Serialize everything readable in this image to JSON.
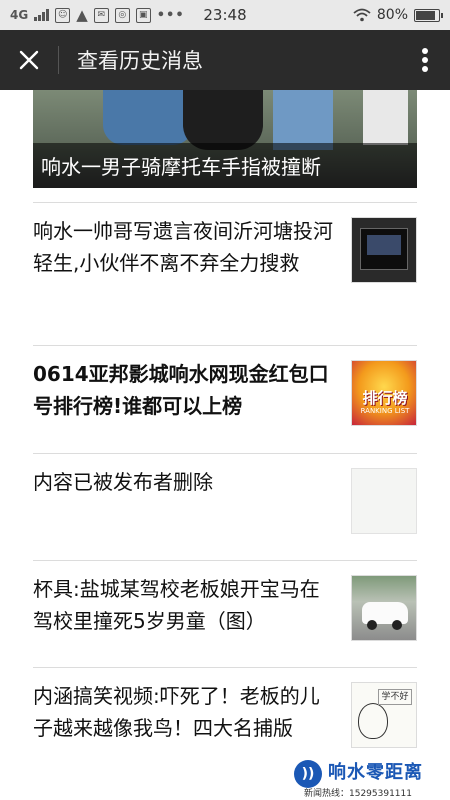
{
  "status_bar": {
    "network": "4G",
    "time": "23:48",
    "battery": "80%",
    "battery_level": 0.8,
    "icons": [
      "signal-icon",
      "notification-icon",
      "warning-icon",
      "message-icon",
      "image-icon",
      "more-dots-icon",
      "wifi-icon",
      "battery-icon"
    ]
  },
  "header": {
    "title": "查看历史消息",
    "close_icon": "close-icon",
    "more_icon": "more-vertical-icon"
  },
  "feed": {
    "cover_title": "响水一男子骑摩托车手指被撞断",
    "articles": [
      {
        "title": "响水一帅哥写遗言夜间沂河塘投河轻生,小伙伴不离不弃全力搜救"
      },
      {
        "title": "0614亚邦影城响水网现金红包口号排行榜!谁都可以上榜",
        "thumb_text": "排行榜",
        "thumb_subtext": "RANKING LIST"
      },
      {
        "title": "内容已被发布者删除"
      },
      {
        "title": "杯具:盐城某驾校老板娘开宝马在驾校里撞死5岁男童（图）"
      },
      {
        "title": "内涵搞笑视频:吓死了！老板的儿子越来越像我鸟！四大名捕版",
        "thumb_text": "学不好"
      }
    ]
  },
  "watermark": {
    "brand": "响水零距离",
    "hotline": "新闻热线：15295391111",
    "url": "www.0515224600.com"
  },
  "colors": {
    "title_bar": "#2b2b2b",
    "status_bar": "#e9e9e9",
    "text": "#111111",
    "divider": "#dcdcdc",
    "brand_blue": "#1b58b5"
  }
}
